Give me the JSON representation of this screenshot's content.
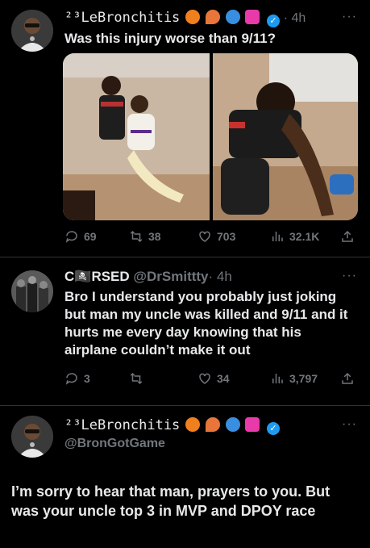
{
  "tweet1": {
    "display_name": "²³LeBronchitis",
    "time": "· 4h",
    "text": "Was this injury worse than 9/11?",
    "replies": "69",
    "retweets": "38",
    "likes": "703",
    "views": "32.1K"
  },
  "tweet2": {
    "display_name": "C🏴‍☠️RSED",
    "handle": "@DrSmittty",
    "time": "· 4h",
    "text": "Bro I understand you probably just joking but man my uncle was killed and 9/11 and it hurts me every day knowing that his airplane couldn’t make it out",
    "replies": "3",
    "retweets": "",
    "likes": "34",
    "views": "3,797"
  },
  "tweet3": {
    "display_name": "²³LeBronchitis",
    "handle": "@BronGotGame",
    "text": "I’m sorry to hear that man, prayers to you. But was your uncle top 3 in MVP and DPOY race"
  },
  "colors": {
    "background": "#000000",
    "text": "#e7e9ea",
    "muted": "#71767b",
    "verified": "#1d9bf0",
    "divider": "#2f3336"
  },
  "icons": [
    "reply-icon",
    "retweet-icon",
    "like-icon",
    "views-icon",
    "share-icon",
    "more-icon",
    "verified-icon"
  ]
}
